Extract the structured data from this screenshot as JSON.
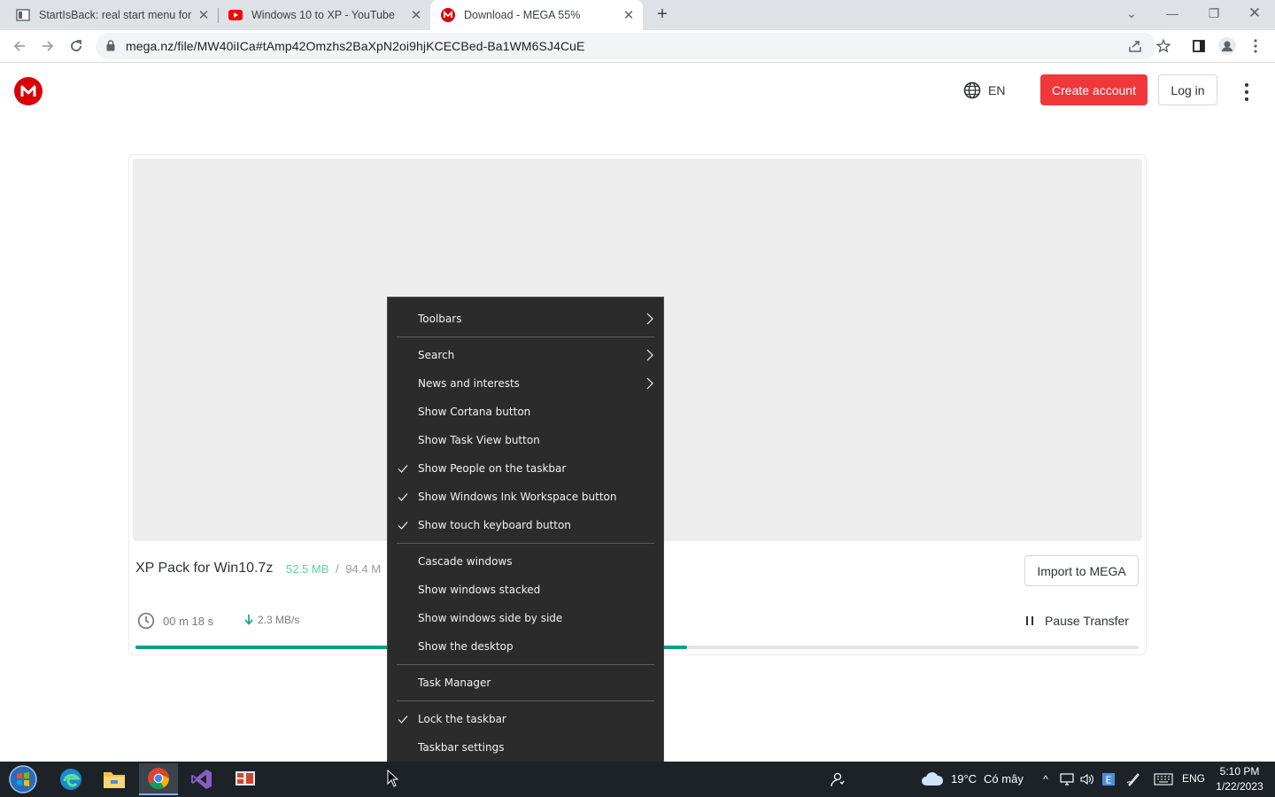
{
  "browser": {
    "tabs": [
      {
        "title": "StartIsBack: real start menu for W",
        "icon": "startisback-favicon",
        "active": false
      },
      {
        "title": "Windows 10 to XP - YouTube",
        "icon": "youtube-favicon",
        "active": false
      },
      {
        "title": "Download - MEGA 55%",
        "icon": "mega-favicon",
        "active": true
      }
    ],
    "url": "mega.nz/file/MW40iICa#tAmp42Omzhs2BaXpN2oi9hjKCECBed-Ba1WM6SJ4CuE"
  },
  "header": {
    "language": "EN",
    "create_account": "Create account",
    "login": "Log in"
  },
  "download": {
    "file_name": "XP Pack for Win10.7z",
    "downloaded": "52.5 MB",
    "separator": "/",
    "total_visible": "94.4 M",
    "import_label": "Import to MEGA",
    "time_left": "00 m  18 s",
    "speed": "2.3 MB/s",
    "pause_label": "Pause Transfer",
    "progress_fraction": 0.55
  },
  "context_menu": {
    "items": [
      {
        "label": "Toolbars",
        "checked": false,
        "submenu": true
      },
      {
        "separator": true
      },
      {
        "label": "Search",
        "checked": false,
        "submenu": true
      },
      {
        "label": "News and interests",
        "checked": false,
        "submenu": true
      },
      {
        "label": "Show Cortana button",
        "checked": false,
        "submenu": false
      },
      {
        "label": "Show Task View button",
        "checked": false,
        "submenu": false
      },
      {
        "label": "Show People on the taskbar",
        "checked": true,
        "submenu": false
      },
      {
        "label": "Show Windows Ink Workspace button",
        "checked": true,
        "submenu": false
      },
      {
        "label": "Show touch keyboard button",
        "checked": true,
        "submenu": false
      },
      {
        "separator": true
      },
      {
        "label": "Cascade windows",
        "checked": false,
        "submenu": false
      },
      {
        "label": "Show windows stacked",
        "checked": false,
        "submenu": false
      },
      {
        "label": "Show windows side by side",
        "checked": false,
        "submenu": false
      },
      {
        "label": "Show the desktop",
        "checked": false,
        "submenu": false
      },
      {
        "separator": true
      },
      {
        "label": "Task Manager",
        "checked": false,
        "submenu": false
      },
      {
        "separator": true
      },
      {
        "label": "Lock the taskbar",
        "checked": true,
        "submenu": false
      },
      {
        "label": "Taskbar settings",
        "checked": false,
        "submenu": false
      }
    ]
  },
  "taskbar": {
    "apps": [
      "start-orb-icon",
      "edge-icon",
      "file-explorer-icon",
      "chrome-icon",
      "visual-studio-icon",
      "app-icon"
    ],
    "weather_temp": "19°C",
    "weather_condition": "Có mây",
    "input_language": "ENG",
    "time": "5:10 PM",
    "date": "1/22/2023"
  },
  "colors": {
    "mega_red": "#d90007",
    "create_button": "#f0373a",
    "progress": "#00a382",
    "menu_bg": "#2b2b2b",
    "taskbar_bg": "#1c2228"
  }
}
